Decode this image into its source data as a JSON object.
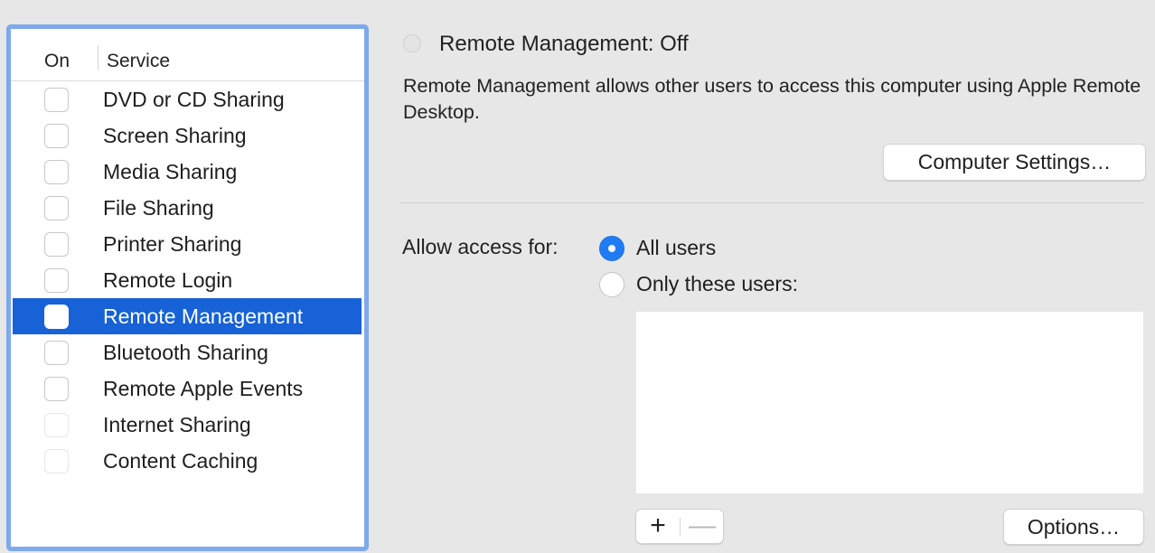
{
  "services_table": {
    "col_on": "On",
    "col_service": "Service",
    "rows": [
      {
        "label": "DVD or CD Sharing",
        "checked": false,
        "enabled": true
      },
      {
        "label": "Screen Sharing",
        "checked": false,
        "enabled": true
      },
      {
        "label": "Media Sharing",
        "checked": false,
        "enabled": true
      },
      {
        "label": "File Sharing",
        "checked": false,
        "enabled": true
      },
      {
        "label": "Printer Sharing",
        "checked": false,
        "enabled": true
      },
      {
        "label": "Remote Login",
        "checked": false,
        "enabled": true
      },
      {
        "label": "Remote Management",
        "checked": false,
        "enabled": true,
        "selected": true
      },
      {
        "label": "Bluetooth Sharing",
        "checked": false,
        "enabled": true
      },
      {
        "label": "Remote Apple Events",
        "checked": false,
        "enabled": true
      },
      {
        "label": "Internet Sharing",
        "checked": false,
        "enabled": false
      },
      {
        "label": "Content Caching",
        "checked": false,
        "enabled": false
      }
    ]
  },
  "detail": {
    "status_title": "Remote Management: Off",
    "description": "Remote Management allows other users to access this computer using Apple Remote Desktop.",
    "computer_settings_label": "Computer Settings…",
    "allow_access_label": "Allow access for:",
    "radio_all_label": "All users",
    "radio_only_label": "Only these users:",
    "selected_access": "All users",
    "add_symbol": "+",
    "remove_symbol": "—",
    "options_label": "Options…"
  },
  "colors": {
    "selection": "#1662d6",
    "focus_ring": "#7ea9ec",
    "radio_accent": "#1f7cf3",
    "window_bg": "#e7e7e7"
  }
}
